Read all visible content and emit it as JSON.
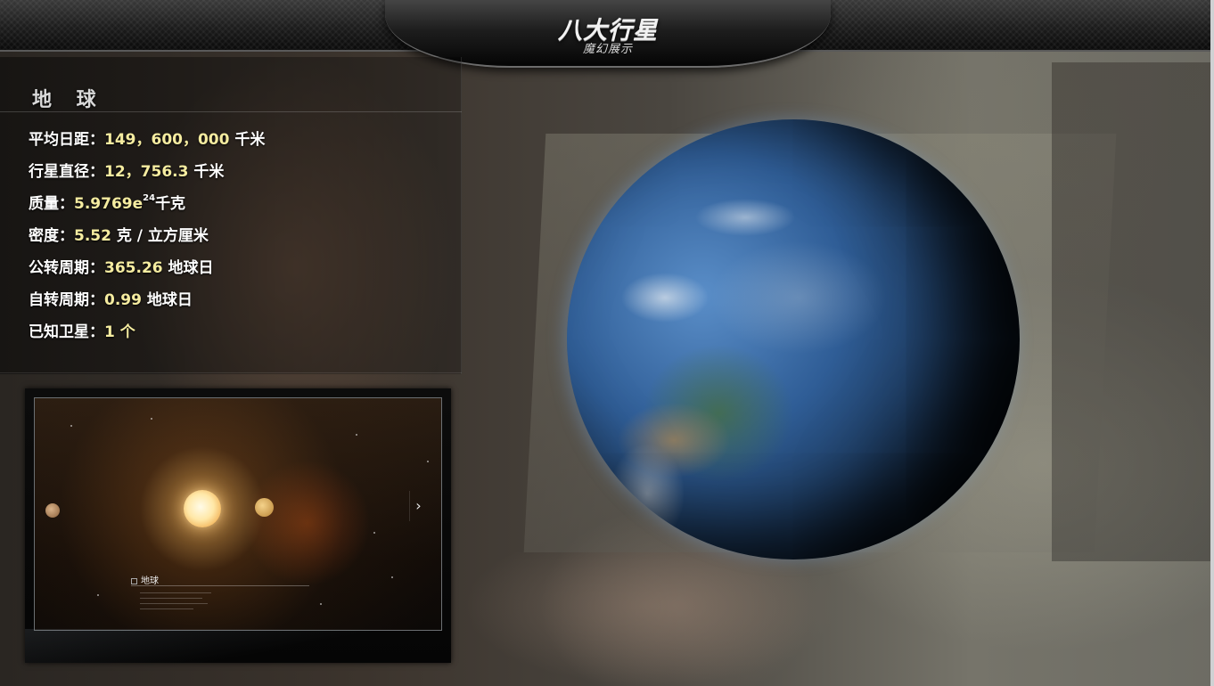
{
  "app": {
    "title": "八大行星",
    "subtitle": "魔幻展示"
  },
  "planet": {
    "name": "地 球",
    "facts": [
      {
        "label": "平均日距：",
        "value": "149，600，000",
        "unit": " 千米"
      },
      {
        "label": "行星直径：",
        "value": "12，756.3",
        "unit": " 千米"
      },
      {
        "label": "质量：",
        "value": "5.9769e",
        "sup": "24",
        "unit": "千克"
      },
      {
        "label": "密度：",
        "value": "5.52",
        "unit": " 克 / 立方厘米"
      },
      {
        "label": "公转周期：",
        "value": "365.26",
        "unit": " 地球日"
      },
      {
        "label": "自转周期：",
        "value": "0.99",
        "unit": " 地球日"
      },
      {
        "label": "已知卫星：",
        "value": "1 个",
        "unit": ""
      }
    ]
  },
  "thumbnail": {
    "caption": "地球",
    "next_icon": "chevron-right-icon",
    "next_glyph": "›"
  },
  "colors": {
    "value_accent": "#f5eca0",
    "label": "#ffffff"
  }
}
